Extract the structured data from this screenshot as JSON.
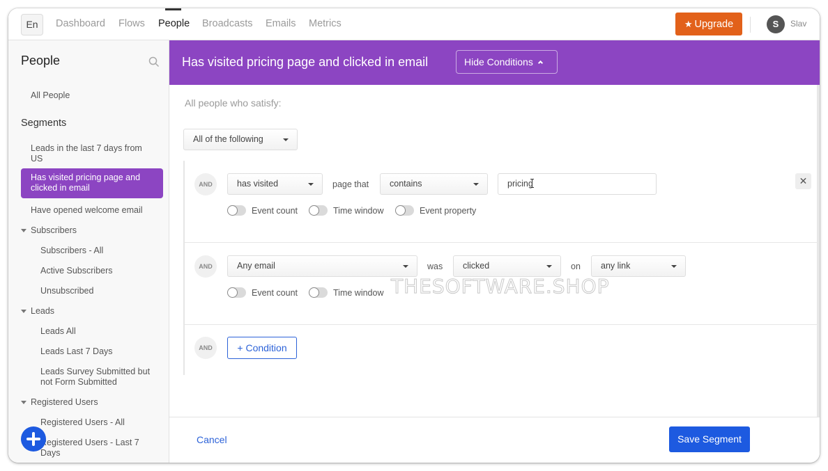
{
  "topnav": {
    "lang": "En",
    "items": [
      {
        "label": "Dashboard",
        "active": false
      },
      {
        "label": "Flows",
        "active": false
      },
      {
        "label": "People",
        "active": true
      },
      {
        "label": "Broadcasts",
        "active": false
      },
      {
        "label": "Emails",
        "active": false
      },
      {
        "label": "Metrics",
        "active": false
      }
    ],
    "upgrade_label": "Upgrade",
    "upgrade_icon": "star-icon",
    "user_initial": "S",
    "user_name": "Slav"
  },
  "sidebar": {
    "title": "People",
    "search_icon": "search-icon",
    "all_people": "All People",
    "segments_heading": "Segments",
    "segments": [
      {
        "label": "Leads in the last 7 days from US",
        "selected": false
      },
      {
        "label": "Has visited pricing page and clicked in email",
        "selected": true
      },
      {
        "label": "Have opened welcome email",
        "selected": false
      }
    ],
    "groups": [
      {
        "label": "Subscribers",
        "expanded": true,
        "items": [
          "Subscribers - All",
          "Active Subscribers",
          "Unsubscribed"
        ]
      },
      {
        "label": "Leads",
        "expanded": true,
        "items": [
          "Leads All",
          "Leads Last 7 Days",
          "Leads Survey Submitted but not Form Submitted"
        ]
      },
      {
        "label": "Registered Users",
        "expanded": true,
        "items": [
          "Registered Users - All",
          "Registered Users - Last 7 Days"
        ]
      }
    ],
    "add_icon": "plus-icon"
  },
  "main": {
    "segment_title": "Has visited pricing page and clicked in email",
    "hide_conditions_label": "Hide Conditions",
    "satisfy_label": "All people who satisfy:",
    "match_select": "All of the following",
    "conditions": [
      {
        "connector": "AND",
        "action_select": "has visited",
        "word1": "page that",
        "operator_select": "contains",
        "value_input": "pricing",
        "toggles": [
          {
            "label": "Event count",
            "on": false
          },
          {
            "label": "Time window",
            "on": false
          },
          {
            "label": "Event property",
            "on": false
          }
        ],
        "remove_icon": "close-icon"
      },
      {
        "connector": "AND",
        "email_select": "Any email",
        "word1": "was",
        "event_select": "clicked",
        "word2": "on",
        "link_select": "any link",
        "toggles": [
          {
            "label": "Event count",
            "on": false
          },
          {
            "label": "Time window",
            "on": false
          }
        ]
      }
    ],
    "add_connector": "AND",
    "add_condition_label": "+ Condition",
    "cancel_label": "Cancel",
    "save_label": "Save Segment",
    "watermark": "THESOFTWARE.SHOP"
  },
  "colors": {
    "accent_purple": "#8c45c2",
    "upgrade_orange": "#e2611a",
    "primary_blue": "#1d5ae0"
  }
}
